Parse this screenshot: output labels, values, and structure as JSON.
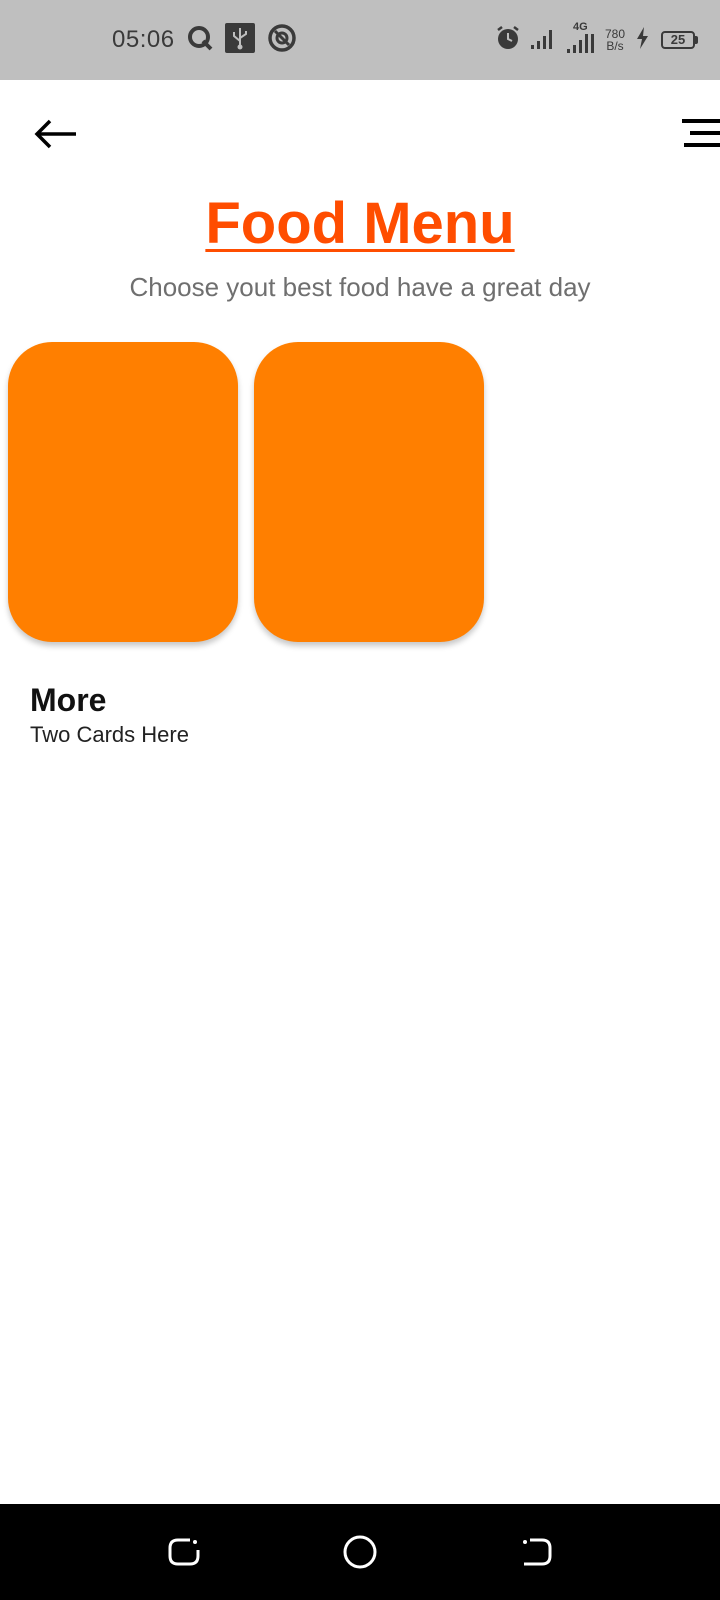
{
  "status_bar": {
    "time": "05:06",
    "network_type": "4G",
    "net_speed_value": "780",
    "net_speed_unit": "B/s",
    "battery_level": "25",
    "icons": [
      "q-app-icon",
      "usb-icon",
      "notification-app-icon",
      "alarm-icon",
      "signal-icon",
      "signal-4g-icon",
      "charging-icon",
      "battery-icon"
    ]
  },
  "app_bar": {
    "back_icon": "arrow-left-icon",
    "menu_icon": "menu-icon"
  },
  "header": {
    "title": "Food Menu",
    "subtitle": "Choose yout best food have a great day",
    "title_color": "#ff4d00"
  },
  "cards": {
    "color": "#ff7f00",
    "count_visible": 2
  },
  "more": {
    "title": "More",
    "subtitle": "Two Cards Here"
  },
  "nav_bar": {
    "icons": [
      "recents-icon",
      "home-icon",
      "back-nav-icon"
    ]
  }
}
